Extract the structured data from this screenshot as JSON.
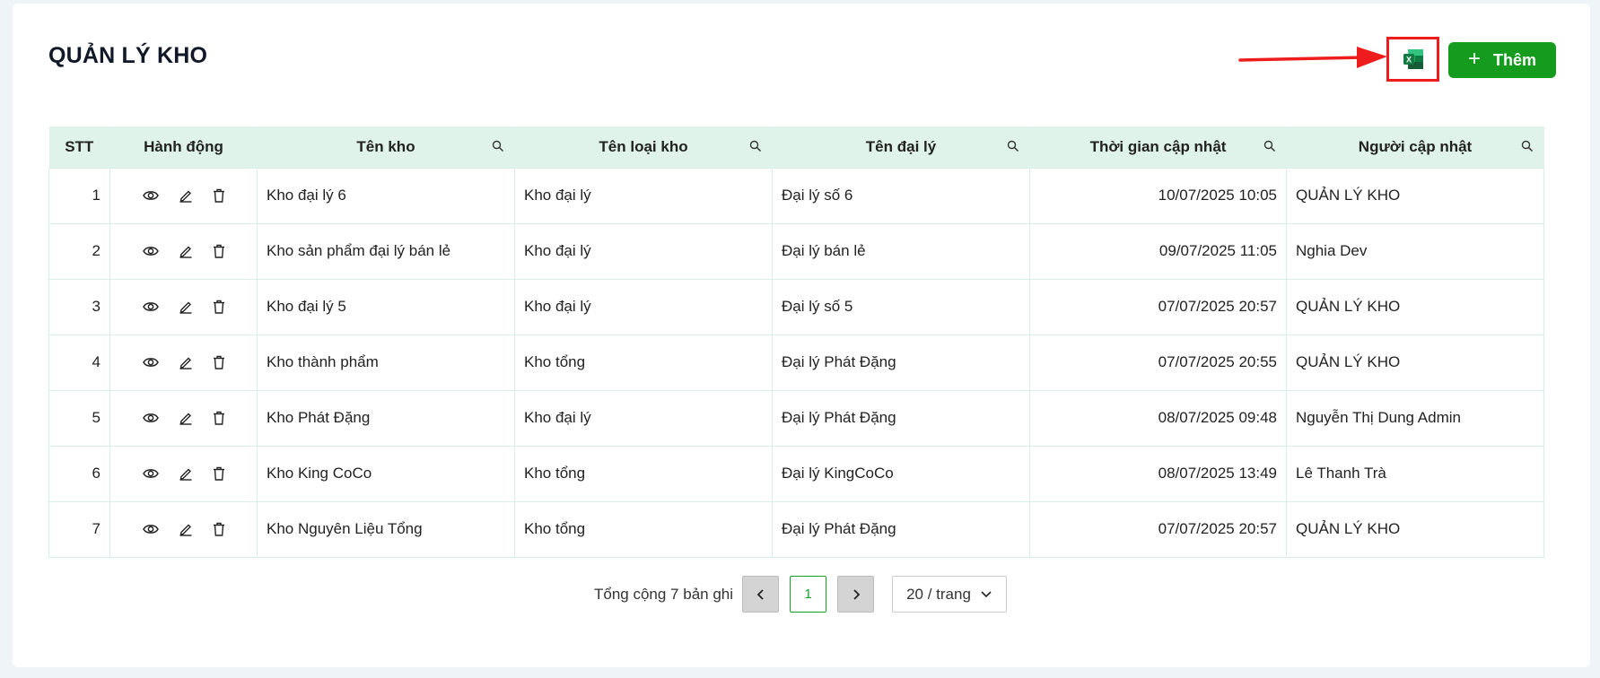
{
  "page": {
    "title": "QUẢN LÝ KHO"
  },
  "toolbar": {
    "excel_icon": "excel-icon",
    "add_label": "Thêm",
    "add_icon": "plus-icon",
    "accent_color": "#159b1e",
    "highlight_color": "#ee1c1c"
  },
  "table": {
    "columns": [
      "STT",
      "Hành động",
      "Tên kho",
      "Tên loại kho",
      "Tên đại lý",
      "Thời gian cập nhật",
      "Người cập nhật"
    ],
    "rows": [
      {
        "stt": "1",
        "ten_kho": "Kho đại lý 6",
        "loai_kho": "Kho đại lý",
        "dai_ly": "Đại lý số 6",
        "thoi_gian": "10/07/2025 10:05",
        "nguoi": "QUẢN LÝ KHO"
      },
      {
        "stt": "2",
        "ten_kho": "Kho sản phẩm đại lý bán lẻ",
        "loai_kho": "Kho đại lý",
        "dai_ly": "Đại lý bán lẻ",
        "thoi_gian": "09/07/2025 11:05",
        "nguoi": "Nghia Dev"
      },
      {
        "stt": "3",
        "ten_kho": "Kho đại lý 5",
        "loai_kho": "Kho đại lý",
        "dai_ly": "Đại lý số 5",
        "thoi_gian": "07/07/2025 20:57",
        "nguoi": "QUẢN LÝ KHO"
      },
      {
        "stt": "4",
        "ten_kho": "Kho thành phẩm",
        "loai_kho": "Kho tổng",
        "dai_ly": "Đại lý Phát Đặng",
        "thoi_gian": "07/07/2025 20:55",
        "nguoi": "QUẢN LÝ KHO"
      },
      {
        "stt": "5",
        "ten_kho": "Kho Phát Đặng",
        "loai_kho": "Kho đại lý",
        "dai_ly": "Đại lý Phát Đặng",
        "thoi_gian": "08/07/2025 09:48",
        "nguoi": "Nguyễn Thị Dung Admin"
      },
      {
        "stt": "6",
        "ten_kho": "Kho King CoCo",
        "loai_kho": "Kho tổng",
        "dai_ly": "Đại lý KingCoCo",
        "thoi_gian": "08/07/2025 13:49",
        "nguoi": "Lê Thanh Trà"
      },
      {
        "stt": "7",
        "ten_kho": "Kho Nguyên Liệu Tổng",
        "loai_kho": "Kho tổng",
        "dai_ly": "Đại lý Phát Đặng",
        "thoi_gian": "07/07/2025 20:57",
        "nguoi": "QUẢN LÝ KHO"
      }
    ]
  },
  "pagination": {
    "total_text": "Tổng cộng 7 bản ghi",
    "current_page": "1",
    "page_size": "20 / trang"
  }
}
